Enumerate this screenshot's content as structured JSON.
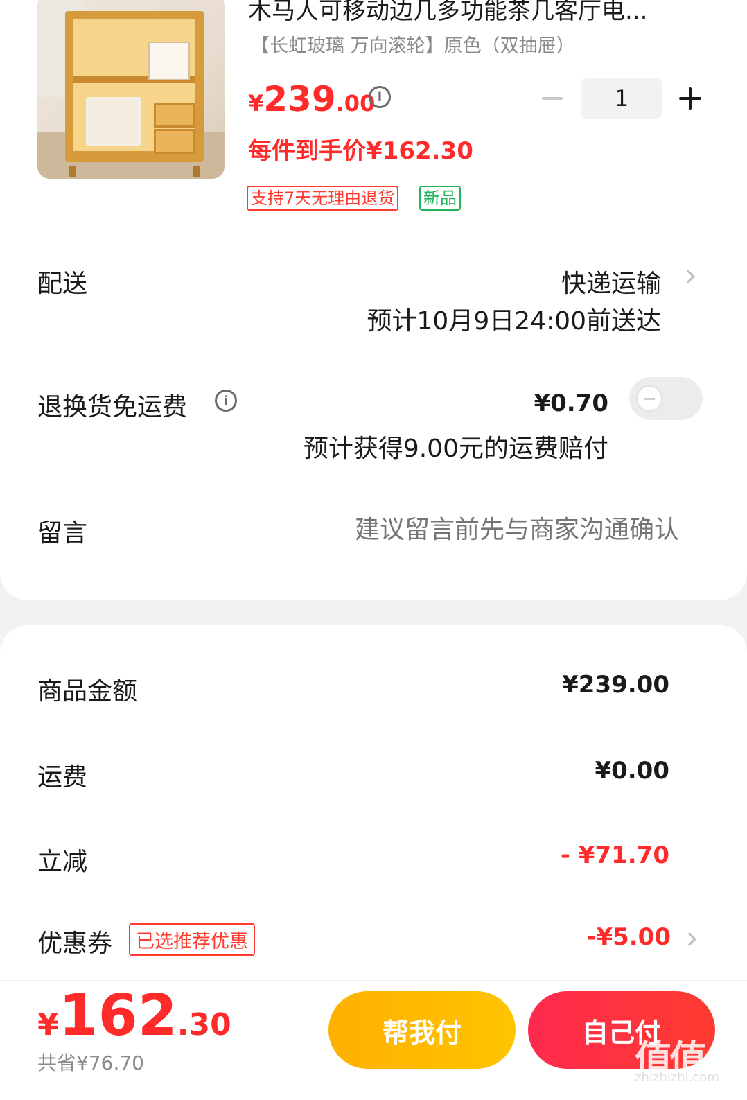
{
  "product": {
    "title": "木马人可移动边几多功能茶几客厅电...",
    "spec": "【长虹玻璃 万向滚轮】原色（双抽屉）",
    "price_symbol": "¥",
    "price_int": "239",
    "price_dec": ".00",
    "per_item_price": "每件到手价¥162.30",
    "quantity": "1",
    "tags": [
      "支持7天无理由退货",
      "新品"
    ]
  },
  "delivery": {
    "label": "配送",
    "method": "快递运输",
    "eta": "预计10月9日24:00前送达"
  },
  "return_shipping": {
    "label": "退换货免运费",
    "price": "¥0.70",
    "note": "预计获得9.00元的运费赔付",
    "enabled": false
  },
  "message": {
    "label": "留言",
    "placeholder": "建议留言前先与商家沟通确认"
  },
  "summary": {
    "goods_label": "商品金额",
    "goods_value": "¥239.00",
    "shipping_label": "运费",
    "shipping_value": "¥0.00",
    "discount_label": "立减",
    "discount_value": "- ¥71.70",
    "coupon_label": "优惠券",
    "coupon_tag": "已选推荐优惠",
    "coupon_value": "-¥5.00"
  },
  "footer": {
    "total_symbol": "¥",
    "total_int": "162",
    "total_dec": ".30",
    "saved": "共省¥76.70",
    "help_pay_label": "帮我付",
    "self_pay_label": "自己付"
  },
  "watermark": {
    "text": "值值值",
    "url": "zhizhizhi.com"
  },
  "colors": {
    "accent_red": "#ff2a2a",
    "tag_green": "#21b35a",
    "help_button": "#ffb000",
    "self_button": "#ff2a4f"
  }
}
